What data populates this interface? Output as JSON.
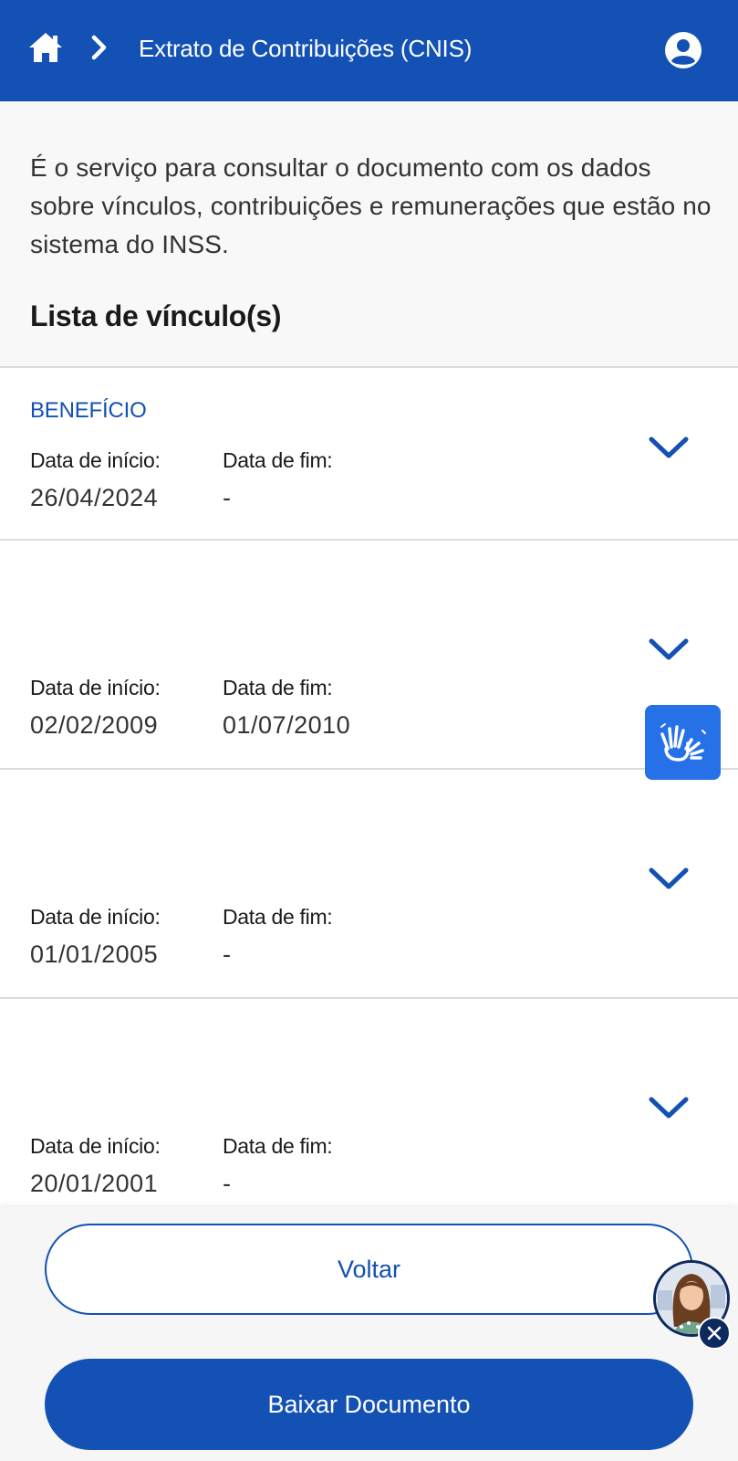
{
  "header": {
    "title": "Extrato de Contribuições (CNIS)",
    "home_icon": "home-icon",
    "separator_icon": "chevron-right-icon",
    "user_icon": "user-circle-icon",
    "background": "#1351b4"
  },
  "intro": "É o serviço para consultar o documento com os dados sobre vínculos, contribuições e remunerações que estão no sistema do INSS.",
  "section_title": "Lista de vínculo(s)",
  "vinculos": [
    {
      "type": "BENEFÍCIO",
      "start_label": "Data de início:",
      "start": "26/04/2024",
      "end_label": "Data de fim:",
      "end": "-"
    },
    {
      "type": "",
      "start_label": "Data de início:",
      "start": "02/02/2009",
      "end_label": "Data de fim:",
      "end": "01/07/2010"
    },
    {
      "type": "",
      "start_label": "Data de início:",
      "start": "01/01/2005",
      "end_label": "Data de fim:",
      "end": "-"
    },
    {
      "type": "",
      "start_label": "Data de início:",
      "start": "20/01/2001",
      "end_label": "Data de fim:",
      "end": "-"
    }
  ],
  "buttons": {
    "back": "Voltar",
    "download": "Baixar Documento"
  },
  "colors": {
    "primary": "#1351b4",
    "libras": "#2670e8"
  }
}
